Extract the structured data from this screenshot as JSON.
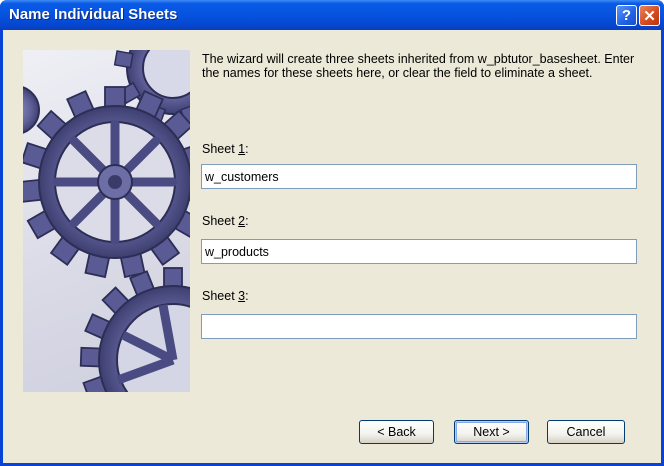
{
  "dialog": {
    "title": "Name Individual Sheets",
    "help_glyph": "?",
    "close_glyph": "✕",
    "intro": "The wizard will create three sheets inherited from w_pbtutor_basesheet.  Enter the names for these sheets here, or clear the field to eliminate a sheet."
  },
  "sheets": [
    {
      "label_prefix": "Sheet ",
      "label_key": "1",
      "label_suffix": ":",
      "value": "w_customers"
    },
    {
      "label_prefix": "Sheet ",
      "label_key": "2",
      "label_suffix": ":",
      "value": "w_products"
    },
    {
      "label_prefix": "Sheet ",
      "label_key": "3",
      "label_suffix": ":",
      "value": ""
    }
  ],
  "buttons": {
    "back": "< Back",
    "next": "Next >",
    "cancel": "Cancel"
  },
  "colors": {
    "title_bar": "#0653e0",
    "dialog_bg": "#ece9d8",
    "gear": "#5a5b95"
  }
}
